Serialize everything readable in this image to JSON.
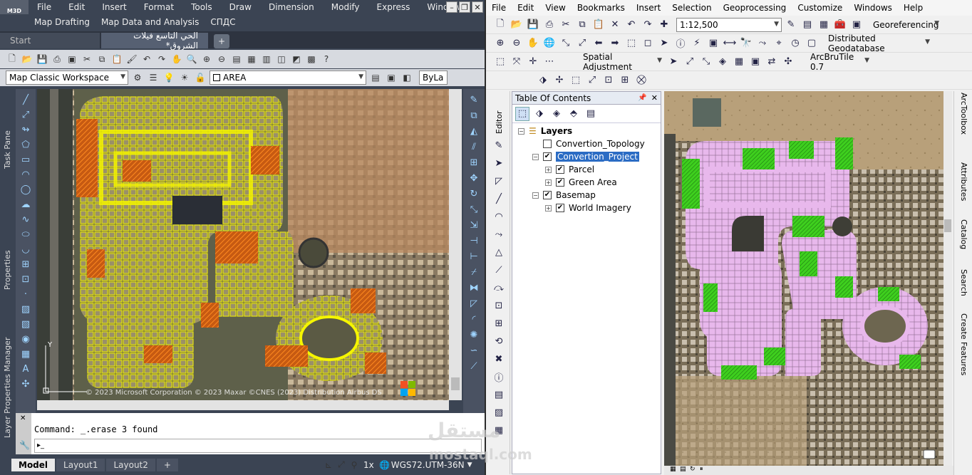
{
  "autocad": {
    "logo": "M3D",
    "menu": [
      "File",
      "Edit",
      "Insert",
      "Format",
      "Tools",
      "Draw",
      "Dimension",
      "Modify",
      "Express",
      "Window"
    ],
    "menu2": [
      "Map Drafting",
      "Map Data and Analysis",
      "СПДС"
    ],
    "tabs": {
      "start": "Start",
      "doc": "الحي التاسع فيلات الشروق*"
    },
    "workspace": "Map Classic Workspace",
    "layer": "AREA",
    "bylayer": "ByLa",
    "left_palettes": [
      "Task Pane",
      "Properties",
      "Layer Properties Manager"
    ],
    "copyright": "© 2023 Microsoft Corporation © 2023 Maxar ©CNES (2023) Distribution Airbus DS",
    "command_history": "Command: _.erase 3 found",
    "layouts": [
      "Model",
      "Layout1",
      "Layout2"
    ],
    "status": {
      "scale": "1x",
      "coord_system": "WGS72.UTM-36N"
    },
    "colors": {
      "parcel_outline": "#f5f500",
      "hatch": "#e86a10"
    }
  },
  "arcmap": {
    "menu": [
      "File",
      "Edit",
      "View",
      "Bookmarks",
      "Insert",
      "Selection",
      "Geoprocessing",
      "Customize",
      "Windows",
      "Help"
    ],
    "scale": "1:12,500",
    "toolbars": {
      "georef": "Georeferencing",
      "distgdb": "Distributed Geodatabase",
      "spatial_adj": "Spatial Adjustment",
      "arcbrutile": "ArcBruTile 0.7"
    },
    "editor_label": "Editor",
    "toc": {
      "title": "Table Of Contents",
      "root": "Layers",
      "items": [
        {
          "label": "Convertion_Topology",
          "checked": false
        },
        {
          "label": "Convertion_Project",
          "checked": true,
          "selected": true
        },
        {
          "label": "Parcel",
          "checked": true
        },
        {
          "label": "Green Area",
          "checked": true
        },
        {
          "label": "Basemap",
          "checked": true
        },
        {
          "label": "World Imagery",
          "checked": true
        }
      ]
    },
    "right_tabs": [
      "ArcToolbox",
      "Attributes",
      "Catalog",
      "Search",
      "Create Features"
    ],
    "colors": {
      "parcel_fill": "#e8b8ec",
      "green_area": "#3ecf1e"
    }
  },
  "watermark": {
    "arabic": "مستقل",
    "latin": "mostaql.com"
  }
}
